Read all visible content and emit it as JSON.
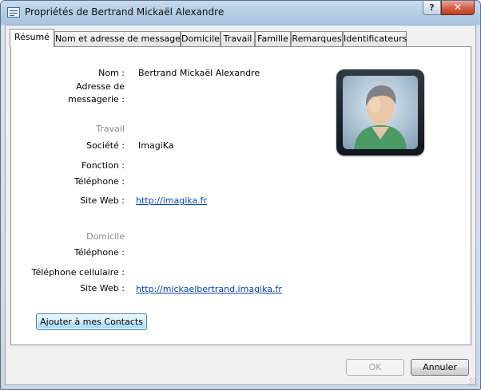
{
  "window": {
    "title": "Propriétés de Bertrand Mickaël Alexandre",
    "help_label": "?",
    "close_label": "✕"
  },
  "tabs": [
    {
      "label": "Résumé",
      "active": true
    },
    {
      "label": "Nom et adresse de messagerie",
      "active": false
    },
    {
      "label": "Domicile",
      "active": false
    },
    {
      "label": "Travail",
      "active": false
    },
    {
      "label": "Famille",
      "active": false
    },
    {
      "label": "Remarques",
      "active": false
    },
    {
      "label": "Identificateurs",
      "active": false
    }
  ],
  "summary": {
    "name_label": "Nom :",
    "name_value": "Bertrand Mickaël Alexandre",
    "email_label_line1": "Adresse de",
    "email_label_line2": "messagerie :",
    "work": {
      "section": "Travail",
      "company_label": "Société :",
      "company_value": "ImagiKa",
      "function_label": "Fonction :",
      "phone_label": "Téléphone :",
      "website_label": "Site Web :",
      "website_value": "http://imagika.fr"
    },
    "home": {
      "section": "Domicile",
      "phone_label": "Téléphone :",
      "mobile_label": "Téléphone cellulaire :",
      "website_label": "Site Web :",
      "website_value": "http://mickaelbertrand.imagika.fr"
    },
    "add_contact_label": "Ajouter à mes Contacts"
  },
  "buttons": {
    "ok_label": "OK",
    "cancel_label": "Annuler"
  },
  "icons": {
    "title": "contact-card-icon",
    "photo": "contact-avatar-icon"
  }
}
